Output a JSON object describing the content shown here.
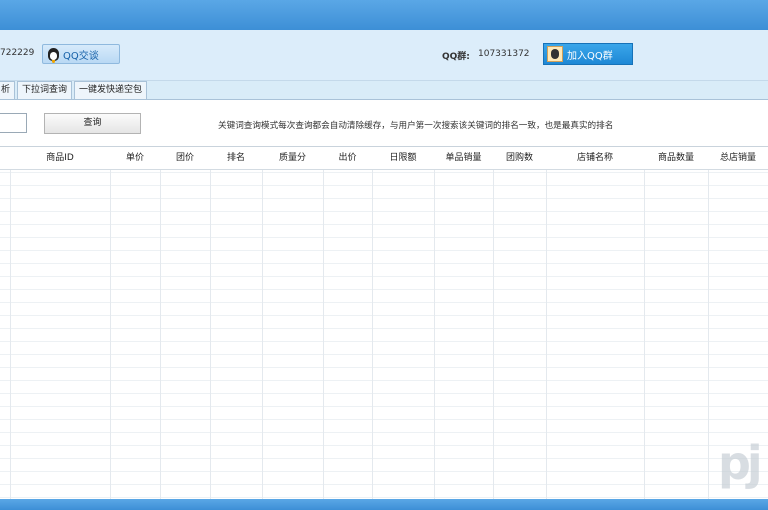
{
  "header": {
    "qq_number_left": "722229",
    "chat_button": "QQ交谈",
    "group_label": "QQ群:",
    "group_number": "107331372",
    "join_button": "加入QQ群"
  },
  "tabs": [
    "析",
    "下拉词查询",
    "一键发快递空包"
  ],
  "toolbar": {
    "keyword_input_value": "",
    "query_button": "查询",
    "notice": "关键词查询模式每次查询都会自动清除缓存，与用户第一次搜索该关键词的排名一致，也是最真实的排名"
  },
  "table": {
    "columns": [
      "商品ID",
      "单价",
      "团价",
      "排名",
      "质量分",
      "出价",
      "日限额",
      "单品销量",
      "团购数",
      "店铺名称",
      "商品数量",
      "总店销量"
    ],
    "rows": []
  },
  "colors": {
    "titlebar": "#3d8fd6",
    "accent_button": "#1e88d6"
  }
}
